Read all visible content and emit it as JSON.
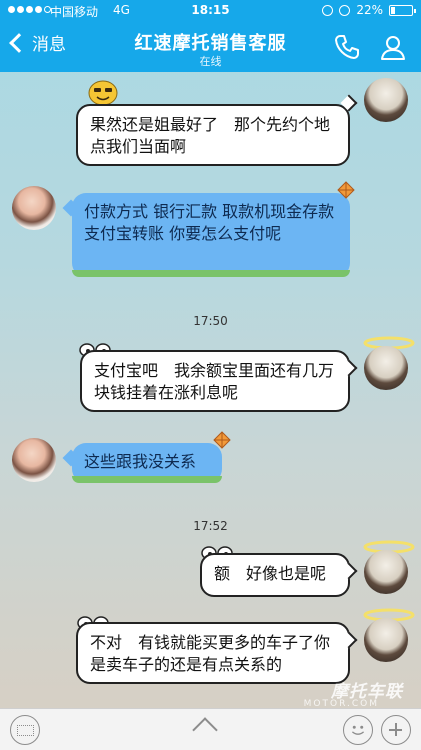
{
  "status_bar": {
    "carrier": "中国移动",
    "network": "4G",
    "time": "18:15",
    "battery": "22%",
    "battery_level": 0.22
  },
  "header": {
    "back_label": "消息",
    "title": "红速摩托销售客服",
    "subtitle": "在线",
    "accent_color": "#16a8ea"
  },
  "messages": [
    {
      "side": "me",
      "text": "果然还是姐最好了　那个先约个地点我们当面啊"
    },
    {
      "side": "her",
      "text": "付款方式 银行汇款 取款机现金存款 支付宝转账 你要怎么支付呢"
    },
    {
      "side": "me",
      "text": "支付宝吧　我余额宝里面还有几万块钱挂着在涨利息呢"
    },
    {
      "side": "her",
      "text": "这些跟我没关系"
    },
    {
      "side": "me",
      "text": "额　好像也是呢"
    },
    {
      "side": "me",
      "text": "不对　有钱就能买更多的车子了你是卖车子的还是有点关系的"
    }
  ],
  "timestamps": [
    "17:50",
    "17:52"
  ],
  "watermark": {
    "main": "摩托车联",
    "sub": "MOTOR.COM"
  }
}
